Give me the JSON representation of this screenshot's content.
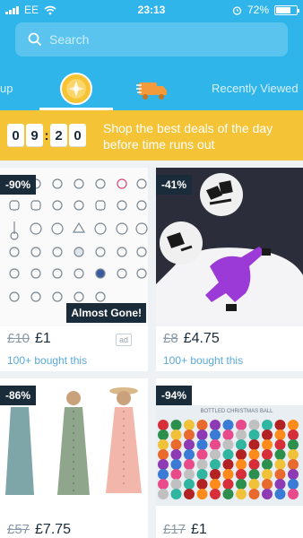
{
  "status_bar": {
    "carrier": "EE",
    "time": "23:13",
    "battery": "72%"
  },
  "search": {
    "placeholder": "Search"
  },
  "tabs": {
    "partial_left": "up",
    "recently_viewed": "Recently Viewed"
  },
  "deals_banner": {
    "timer": {
      "h1": "0",
      "h2": "9",
      "m1": "2",
      "m2": "0"
    },
    "text": "Shop the best deals of the day before time runs out"
  },
  "products": [
    {
      "discount": "-90%",
      "badge": "Almost Gone!",
      "old_price": "£10",
      "new_price": "£1",
      "bought": "100+ bought this",
      "ad": "ad"
    },
    {
      "discount": "-41%",
      "old_price": "£8",
      "new_price": "£4.75",
      "bought": "100+ bought this"
    },
    {
      "discount": "-86%",
      "old_price": "£57",
      "new_price": "£7.75"
    },
    {
      "discount": "-94%",
      "old_price": "£17",
      "new_price": "£1",
      "image_caption": "BOTTLED CHRISTMAS BALL"
    }
  ],
  "colors": {
    "header": "#2fb5ea",
    "banner": "#f4c336",
    "badge": "#1a2b3a",
    "accent": "#5aa9d6"
  }
}
